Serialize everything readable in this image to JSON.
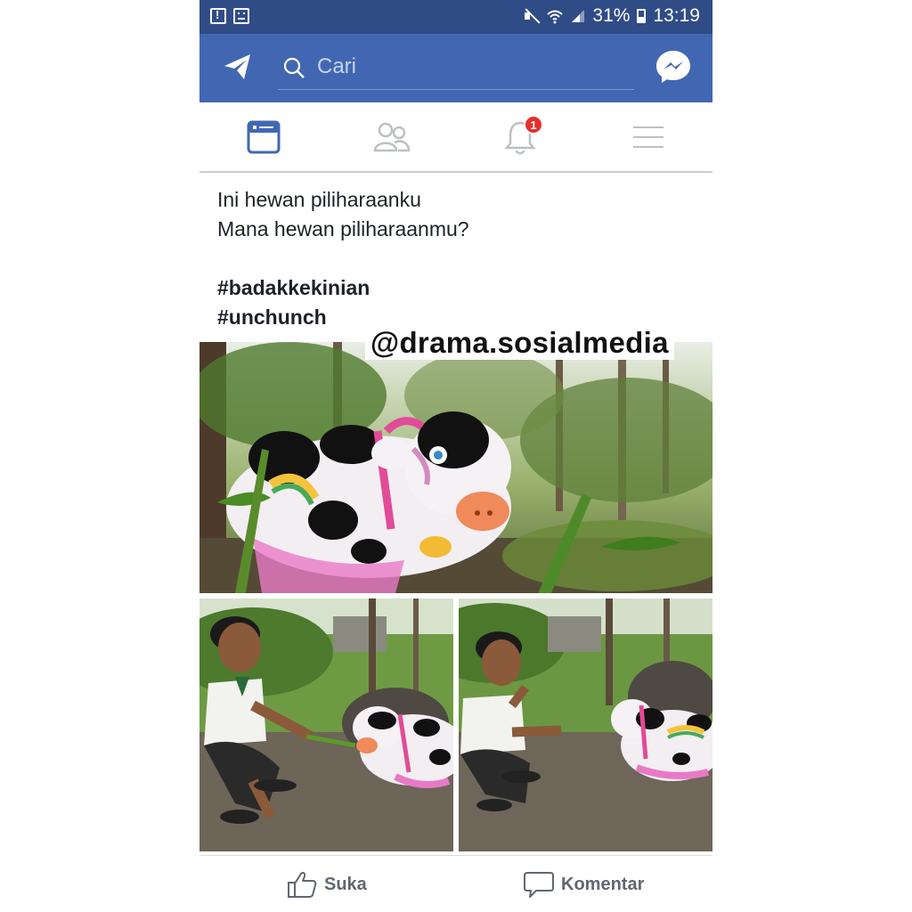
{
  "status_bar": {
    "battery": "31%",
    "time": "13:19",
    "icons": [
      "alert-icon",
      "screenshot-icon",
      "mute-icon",
      "wifi-icon",
      "signal-icon",
      "battery-icon"
    ]
  },
  "app_bar": {
    "search_placeholder": "Cari",
    "icons": [
      "send-icon",
      "search-icon",
      "messenger-icon"
    ],
    "accent_color": "#4267b2"
  },
  "tabs": [
    {
      "name": "news-feed",
      "icon": "news-feed-icon",
      "active": true
    },
    {
      "name": "friends",
      "icon": "friends-icon",
      "active": false
    },
    {
      "name": "notifications",
      "icon": "bell-icon",
      "active": false,
      "badge": "1"
    },
    {
      "name": "menu",
      "icon": "menu-icon",
      "active": false
    }
  ],
  "post": {
    "line1": "Ini hewan piliharaanku",
    "line2": "Mana hewan piliharaanmu?",
    "hashtag1": "#badakkekinian",
    "hashtag2": "#unchunch",
    "watermark": "@drama.sosialmedia",
    "photos": [
      "cow-balloon-photo",
      "boy-feeding-balloon-photo",
      "boy-eating-leaf-photo"
    ]
  },
  "actions": {
    "like_label": "Suka",
    "comment_label": "Komentar"
  }
}
